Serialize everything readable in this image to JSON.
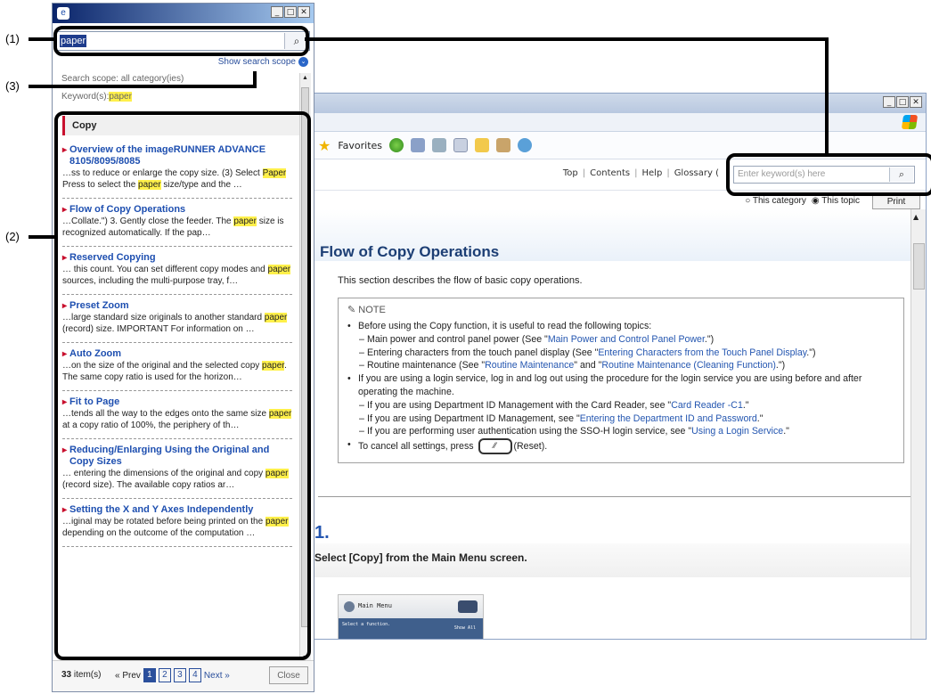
{
  "callouts": [
    "(1)",
    "(2)",
    "(3)"
  ],
  "browser": {
    "toolbar": {
      "favorites_label": "Favorites"
    },
    "nav": [
      "Top",
      "Contents",
      "Help",
      "Glossary ("
    ],
    "search_placeholder": "Enter keyword(s) here",
    "scope": {
      "category": "This category",
      "topic": "This topic",
      "selected": "topic"
    },
    "print_label": "Print",
    "topic": {
      "title": "Flow of Copy Operations",
      "intro": "This section describes the flow of basic copy operations.",
      "note_label": "NOTE",
      "note": {
        "b1": "Before using the Copy function, it is useful to read the following topics:",
        "s1_pre": "Main power and control panel power (See \"",
        "s1_link": "Main Power and Control Panel Power",
        "s1_post": ".\")",
        "s2_pre": "Entering characters from the touch panel display (See \"",
        "s2_link": "Entering Characters from the Touch Panel Display",
        "s2_post": ".\")",
        "s3_pre": "Routine maintenance (See \"",
        "s3_link1": "Routine Maintenance",
        "s3_mid": "\" and \"",
        "s3_link2": "Routine Maintenance (Cleaning Function)",
        "s3_post": ".\")",
        "b2": "If you are using a login service, log in and log out using the procedure for the login service you are using before and after operating the machine.",
        "s4_pre": "If you are using Department ID Management with the Card Reader, see \"",
        "s4_link": "Card Reader -C1",
        "s4_post": ".\"",
        "s5_pre": "If you are using Department ID Management, see \"",
        "s5_link": "Entering the Department ID and Password",
        "s5_post": ".\"",
        "s6_pre": "If you are performing user authentication using the SSO-H login service, see \"",
        "s6_link": "Using a Login Service",
        "s6_post": ".\"",
        "b3_pre": "To cancel all settings, press",
        "b3_post": "(Reset)."
      },
      "step_number": "1.",
      "step_text": "Select [Copy] from the Main Menu screen.",
      "screen": {
        "title": "Main Menu",
        "sub": "Select a function.",
        "show_all": "Show All"
      }
    }
  },
  "panel": {
    "search_value": "paper",
    "show_scope_label": "Show search scope",
    "scope_text": "Search scope: all category(ies)",
    "keyword_label": "Keyword(s):",
    "keyword_value": "paper",
    "category": "Copy",
    "results": [
      {
        "title": "Overview of the imageRUNNER ADVANCE 8105/8095/8085",
        "snip": [
          "…ss to reduce or enlarge the copy size. (3) Select ",
          "Paper",
          " Press to select the ",
          "paper",
          " size/type and the …"
        ]
      },
      {
        "title": "Flow of Copy Operations",
        "snip": [
          "…Collate.\") 3. Gently close the feeder. The ",
          "paper",
          " size is recognized automatically. If the pap…",
          "",
          ""
        ]
      },
      {
        "title": "Reserved Copying",
        "snip": [
          "… this count. You can set different copy modes and ",
          "paper",
          " sources, including the multi-purpose tray, f…",
          "",
          ""
        ]
      },
      {
        "title": "Preset Zoom",
        "snip": [
          "…large standard size originals to another standard ",
          "paper",
          " (record) size. IMPORTANT For information on …",
          "",
          ""
        ]
      },
      {
        "title": "Auto Zoom",
        "snip": [
          "…on the size of the original and the selected copy ",
          "paper",
          ". The same copy ratio is used for the horizon…",
          "",
          ""
        ]
      },
      {
        "title": "Fit to Page",
        "snip": [
          "…tends all the way to the edges onto the same size ",
          "paper",
          " at a copy ratio of 100%, the periphery of th…",
          "",
          ""
        ]
      },
      {
        "title": "Reducing/Enlarging Using the Original and Copy Sizes",
        "snip": [
          "… entering the dimensions of the original and copy ",
          "paper",
          " (record size). The available copy ratios ar…",
          "",
          ""
        ]
      },
      {
        "title": "Setting the X and Y Axes Independently",
        "snip": [
          "…iginal may be rotated before being printed on the ",
          "paper",
          " depending on the outcome of the computation …",
          "",
          ""
        ]
      }
    ],
    "footer": {
      "count": "33",
      "count_suffix": "item(s)",
      "prev": "« Prev",
      "pages": [
        "1",
        "2",
        "3",
        "4"
      ],
      "current_page": "1",
      "next": "Next »",
      "close_label": "Close"
    }
  }
}
